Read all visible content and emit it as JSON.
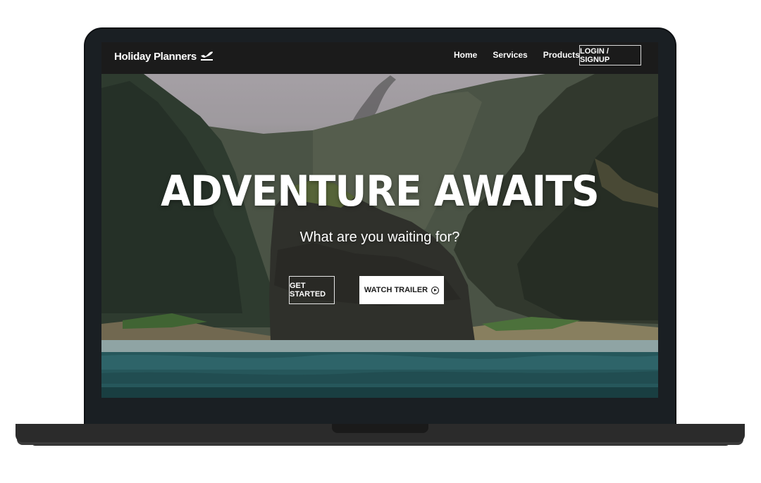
{
  "navbar": {
    "brand": "Holiday Planners",
    "brand_icon": "airplane-takeoff-icon",
    "links": [
      {
        "label": "Home"
      },
      {
        "label": "Services"
      },
      {
        "label": "Products"
      }
    ],
    "login_label": "LOGIN / SIGNUP"
  },
  "hero": {
    "headline": "ADVENTURE AWAITS",
    "subheadline": "What are you waiting for?",
    "primary_button": "GET STARTED",
    "secondary_button": "WATCH TRAILER",
    "secondary_button_icon": "play-circle-icon"
  },
  "colors": {
    "navbar_bg": "#1b1b1b",
    "laptop_frame": "#1a1f23",
    "text_light": "#ffffff"
  }
}
